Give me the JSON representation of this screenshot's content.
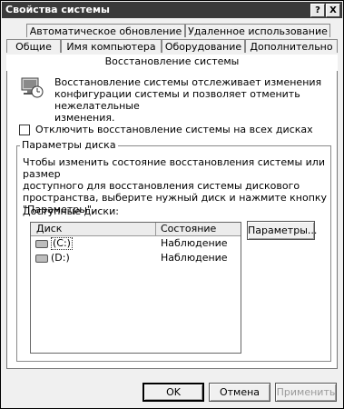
{
  "window": {
    "title": "Свойства системы"
  },
  "titlebar_buttons": {
    "help": "?",
    "close": "X"
  },
  "tabs_row1": [
    "Автоматическое обновление",
    "Удаленное использование"
  ],
  "tabs_row2": [
    "Общие",
    "Имя компьютера",
    "Оборудование",
    "Дополнительно"
  ],
  "active_tab": "Восстановление системы",
  "intro_text": [
    "Восстановление системы отслеживает изменения",
    "конфигурации системы и позволяет отменить нежелательные",
    "изменения."
  ],
  "disable_checkbox": {
    "label": "Отключить восстановление системы на всех дисках",
    "checked": false
  },
  "disk_params": {
    "legend": "Параметры диска",
    "description": [
      "Чтобы изменить состояние восстановления системы или размер",
      "доступного для восстановления системы дискового",
      "пространства, выберите нужный диск и нажмите кнопку",
      "\"Параметры\"."
    ],
    "available_label": "Доступные диски:",
    "columns": [
      "Диск",
      "Состояние"
    ],
    "rows": [
      {
        "disk": "(C:)",
        "state": "Наблюдение"
      },
      {
        "disk": "(D:)",
        "state": "Наблюдение"
      }
    ],
    "settings_button": "Параметры..."
  },
  "footer": {
    "ok": "OK",
    "cancel": "Отмена",
    "apply": "Применить"
  }
}
